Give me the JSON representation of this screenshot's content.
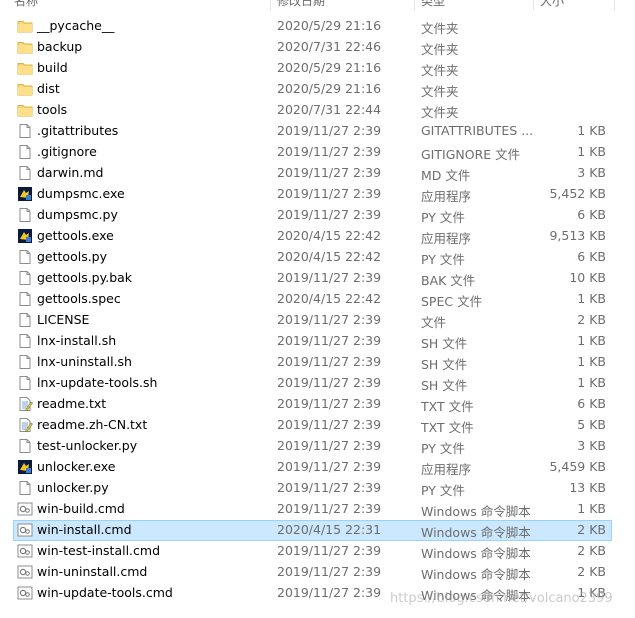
{
  "header": {
    "col_name": "名称",
    "col_date": "修改日期",
    "col_type": "类型",
    "col_size": "大小"
  },
  "files": [
    {
      "name": "__pycache__",
      "date": "2020/5/29 21:16",
      "type": "文件夹",
      "size": "",
      "icon": "folder"
    },
    {
      "name": "backup",
      "date": "2020/7/31 22:46",
      "type": "文件夹",
      "size": "",
      "icon": "folder"
    },
    {
      "name": "build",
      "date": "2020/5/29 21:16",
      "type": "文件夹",
      "size": "",
      "icon": "folder"
    },
    {
      "name": "dist",
      "date": "2020/5/29 21:16",
      "type": "文件夹",
      "size": "",
      "icon": "folder"
    },
    {
      "name": "tools",
      "date": "2020/7/31 22:44",
      "type": "文件夹",
      "size": "",
      "icon": "folder"
    },
    {
      "name": ".gitattributes",
      "date": "2019/11/27 2:39",
      "type": "GITATTRIBUTES ...",
      "size": "1 KB",
      "icon": "file"
    },
    {
      "name": ".gitignore",
      "date": "2019/11/27 2:39",
      "type": "GITIGNORE 文件",
      "size": "1 KB",
      "icon": "file"
    },
    {
      "name": "darwin.md",
      "date": "2019/11/27 2:39",
      "type": "MD 文件",
      "size": "3 KB",
      "icon": "file"
    },
    {
      "name": "dumpsmc.exe",
      "date": "2019/11/27 2:39",
      "type": "应用程序",
      "size": "5,452 KB",
      "icon": "exe"
    },
    {
      "name": "dumpsmc.py",
      "date": "2019/11/27 2:39",
      "type": "PY 文件",
      "size": "6 KB",
      "icon": "file"
    },
    {
      "name": "gettools.exe",
      "date": "2020/4/15 22:42",
      "type": "应用程序",
      "size": "9,513 KB",
      "icon": "exe"
    },
    {
      "name": "gettools.py",
      "date": "2020/4/15 22:42",
      "type": "PY 文件",
      "size": "6 KB",
      "icon": "file"
    },
    {
      "name": "gettools.py.bak",
      "date": "2019/11/27 2:39",
      "type": "BAK 文件",
      "size": "10 KB",
      "icon": "file"
    },
    {
      "name": "gettools.spec",
      "date": "2020/4/15 22:42",
      "type": "SPEC 文件",
      "size": "1 KB",
      "icon": "file"
    },
    {
      "name": "LICENSE",
      "date": "2019/11/27 2:39",
      "type": "文件",
      "size": "2 KB",
      "icon": "file"
    },
    {
      "name": "lnx-install.sh",
      "date": "2019/11/27 2:39",
      "type": "SH 文件",
      "size": "1 KB",
      "icon": "file"
    },
    {
      "name": "lnx-uninstall.sh",
      "date": "2019/11/27 2:39",
      "type": "SH 文件",
      "size": "1 KB",
      "icon": "file"
    },
    {
      "name": "lnx-update-tools.sh",
      "date": "2019/11/27 2:39",
      "type": "SH 文件",
      "size": "1 KB",
      "icon": "file"
    },
    {
      "name": "readme.txt",
      "date": "2019/11/27 2:39",
      "type": "TXT 文件",
      "size": "6 KB",
      "icon": "txt"
    },
    {
      "name": "readme.zh-CN.txt",
      "date": "2019/11/27 2:39",
      "type": "TXT 文件",
      "size": "5 KB",
      "icon": "txt"
    },
    {
      "name": "test-unlocker.py",
      "date": "2019/11/27 2:39",
      "type": "PY 文件",
      "size": "3 KB",
      "icon": "file"
    },
    {
      "name": "unlocker.exe",
      "date": "2019/11/27 2:39",
      "type": "应用程序",
      "size": "5,459 KB",
      "icon": "exe"
    },
    {
      "name": "unlocker.py",
      "date": "2019/11/27 2:39",
      "type": "PY 文件",
      "size": "13 KB",
      "icon": "file"
    },
    {
      "name": "win-build.cmd",
      "date": "2019/11/27 2:39",
      "type": "Windows 命令脚本",
      "size": "1 KB",
      "icon": "cmd"
    },
    {
      "name": "win-install.cmd",
      "date": "2020/4/15 22:31",
      "type": "Windows 命令脚本",
      "size": "2 KB",
      "icon": "cmd",
      "selected": true
    },
    {
      "name": "win-test-install.cmd",
      "date": "2019/11/27 2:39",
      "type": "Windows 命令脚本",
      "size": "2 KB",
      "icon": "cmd"
    },
    {
      "name": "win-uninstall.cmd",
      "date": "2019/11/27 2:39",
      "type": "Windows 命令脚本",
      "size": "2 KB",
      "icon": "cmd"
    },
    {
      "name": "win-update-tools.cmd",
      "date": "2019/11/27 2:39",
      "type": "Windows 命令脚本",
      "size": "1 KB",
      "icon": "cmd"
    }
  ],
  "watermark": "https://blog.csdn.net/volcano2399"
}
